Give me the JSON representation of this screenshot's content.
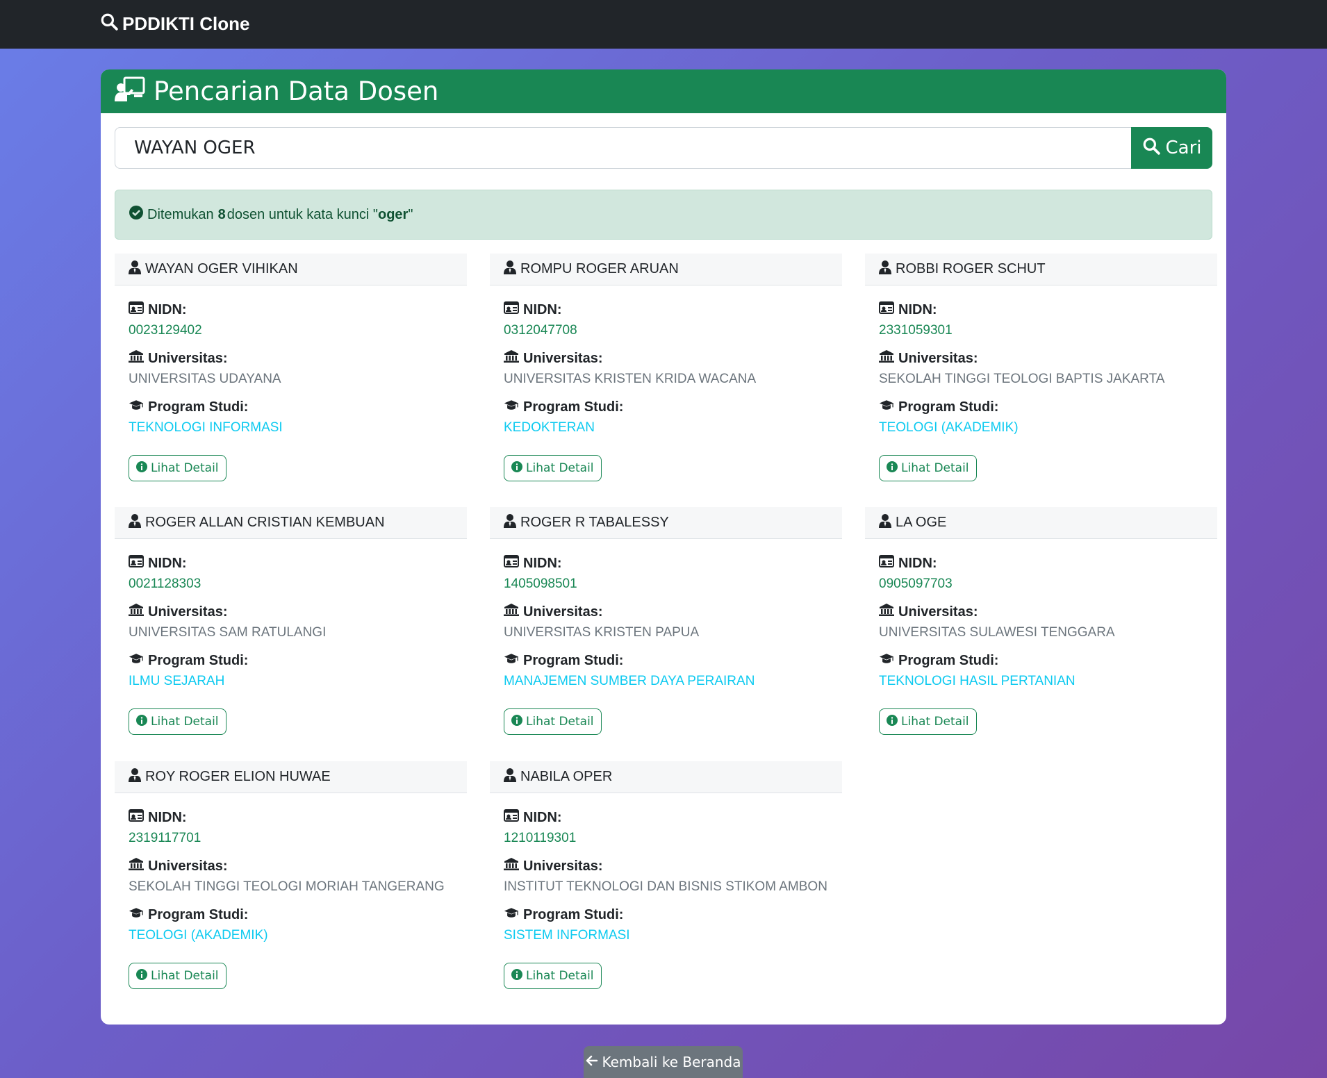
{
  "navbar": {
    "brand": "PDDIKTI Clone"
  },
  "header": {
    "title": "Pencarian Data Dosen"
  },
  "search": {
    "value": "WAYAN OGER",
    "button_label": "Cari"
  },
  "alert": {
    "prefix": "Ditemukan",
    "count": "8",
    "middle": "dosen untuk kata kunci \"",
    "keyword": "oger",
    "suffix": "\""
  },
  "labels": {
    "nidn": "NIDN:",
    "universitas": "Universitas:",
    "prodi": "Program Studi:",
    "detail": "Lihat Detail"
  },
  "results": [
    {
      "name": "WAYAN OGER VIHIKAN",
      "nidn": "0023129402",
      "universitas": "UNIVERSITAS UDAYANA",
      "prodi": "TEKNOLOGI INFORMASI"
    },
    {
      "name": "ROMPU ROGER ARUAN",
      "nidn": "0312047708",
      "universitas": "UNIVERSITAS KRISTEN KRIDA WACANA",
      "prodi": "KEDOKTERAN"
    },
    {
      "name": "ROBBI ROGER SCHUT",
      "nidn": "2331059301",
      "universitas": "SEKOLAH TINGGI TEOLOGI BAPTIS JAKARTA",
      "prodi": "TEOLOGI (AKADEMIK)"
    },
    {
      "name": "ROGER ALLAN CRISTIAN KEMBUAN",
      "nidn": "0021128303",
      "universitas": "UNIVERSITAS SAM RATULANGI",
      "prodi": "ILMU SEJARAH"
    },
    {
      "name": "ROGER R TABALESSY",
      "nidn": "1405098501",
      "universitas": "UNIVERSITAS KRISTEN PAPUA",
      "prodi": "MANAJEMEN SUMBER DAYA PERAIRAN"
    },
    {
      "name": "LA OGE",
      "nidn": "0905097703",
      "universitas": "UNIVERSITAS SULAWESI TENGGARA",
      "prodi": "TEKNOLOGI HASIL PERTANIAN"
    },
    {
      "name": "ROY ROGER ELION HUWAE",
      "nidn": "2319117701",
      "universitas": "SEKOLAH TINGGI TEOLOGI MORIAH TANGERANG",
      "prodi": "TEOLOGI (AKADEMIK)"
    },
    {
      "name": "NABILA OPER",
      "nidn": "1210119301",
      "universitas": "INSTITUT TEKNOLOGI DAN BISNIS STIKOM AMBON",
      "prodi": "SISTEM INFORMASI"
    }
  ],
  "footer": {
    "back_label": "Kembali ke Beranda"
  },
  "colors": {
    "primary": "#198754",
    "navbar": "#212529",
    "cyan": "#0dcaf0",
    "alert_bg": "#d1e7dd"
  }
}
